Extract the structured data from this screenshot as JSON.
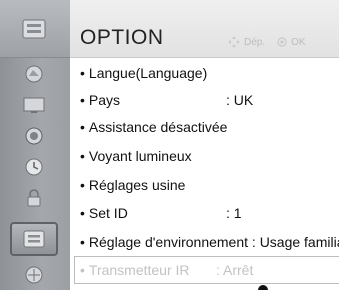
{
  "header": {
    "title": "OPTION",
    "move_hint": "Dép.",
    "ok_hint": "OK"
  },
  "sidebar": {
    "items": [
      {
        "name": "header-icon"
      },
      {
        "name": "picture-icon"
      },
      {
        "name": "screen-icon"
      },
      {
        "name": "sound-icon"
      },
      {
        "name": "clock-icon"
      },
      {
        "name": "lock-icon"
      },
      {
        "name": "option-icon",
        "active": true
      },
      {
        "name": "network-icon"
      }
    ]
  },
  "menu": {
    "items": [
      {
        "label": "Langue(Language)",
        "value": ""
      },
      {
        "label": "Pays",
        "value": ": UK"
      },
      {
        "label": "Assistance désactivée",
        "value": ""
      },
      {
        "label": "Voyant lumineux",
        "value": ""
      },
      {
        "label": "Réglages usine",
        "value": ""
      },
      {
        "label": "Set ID",
        "value": ": 1"
      },
      {
        "label": "Réglage d'environnement : Usage familia",
        "value": ""
      },
      {
        "label": "Transmetteur IR",
        "value": ": Arrêt"
      }
    ]
  },
  "colors": {
    "sidebar": "#9ea1a5",
    "topbar": "#e8e8e8",
    "text": "#111111",
    "dim_text": "#c3c3c3"
  }
}
